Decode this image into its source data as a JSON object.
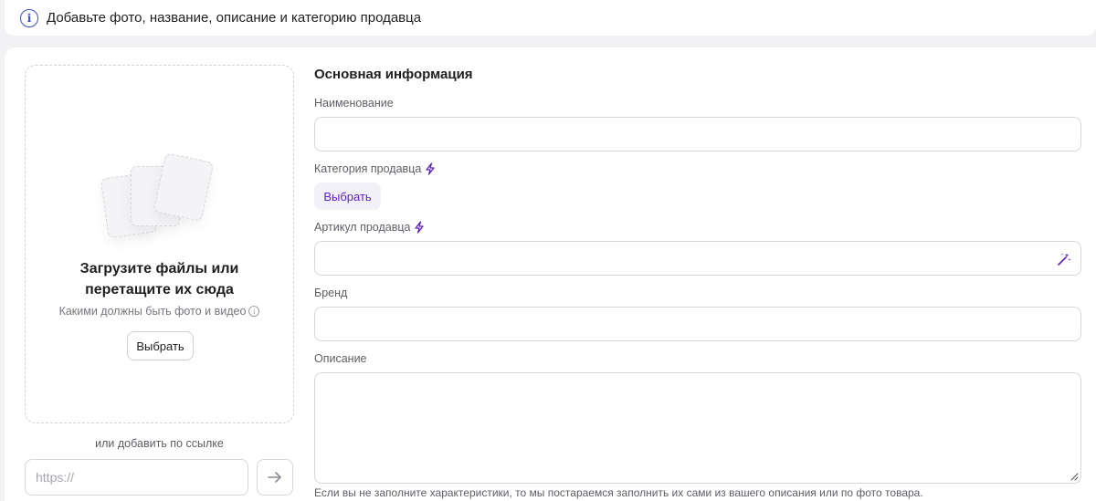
{
  "banner": {
    "icon": "info-icon",
    "text": "Добавьте фото, название, описание и категорию продавца"
  },
  "upload": {
    "title_line1": "Загрузите файлы или",
    "title_line2": "перетащите их сюда",
    "hint": "Какими должны быть фото и видео",
    "button_label": "Выбрать",
    "or_link": "или добавить по ссылке",
    "url_placeholder": "https://",
    "submit_icon": "arrow-right-icon"
  },
  "form": {
    "section_title": "Основная информация",
    "name_label": "Наименование",
    "name_value": "",
    "category_label": "Категория продавца",
    "category_button": "Выбрать",
    "article_label": "Артикул продавца",
    "article_value": "",
    "brand_label": "Бренд",
    "brand_value": "",
    "description_label": "Описание",
    "description_value": "",
    "description_hint": "Если вы не заполните характеристики, то мы постараемся заполнить их сами из вашего описания или по фото товара."
  },
  "colors": {
    "accent": "#5b1fc4",
    "info": "#3d4fd6",
    "border": "#d6d6dc",
    "background": "#f2f2f4"
  }
}
